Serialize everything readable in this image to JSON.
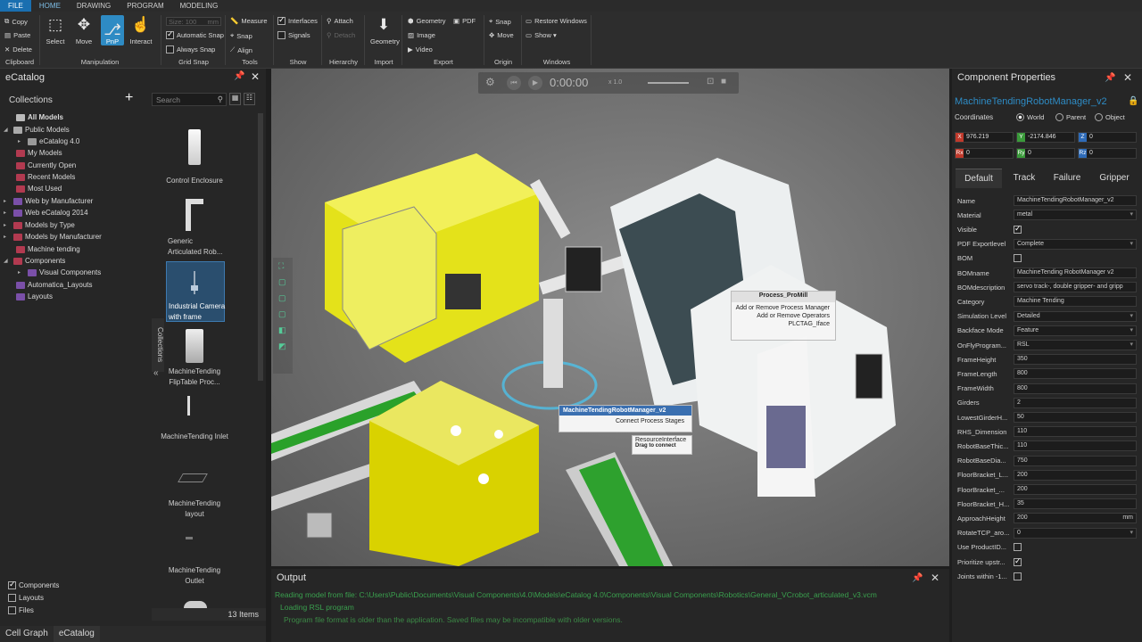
{
  "menu": {
    "items": [
      "FILE",
      "HOME",
      "DRAWING",
      "PROGRAM",
      "MODELING"
    ]
  },
  "ribbon": {
    "clipboard": {
      "copy": "Copy",
      "paste": "Paste",
      "delete": "Delete",
      "label": "Clipboard"
    },
    "manipulation": {
      "select": "Select",
      "move": "Move",
      "pnp": "PnP",
      "interact": "Interact",
      "label": "Manipulation"
    },
    "grid_snap": {
      "size_placeholder": "Size: 100",
      "size_unit": "mm",
      "automatic_snap": "Automatic Snap",
      "always_snap": "Always Snap",
      "label": "Grid Snap"
    },
    "tools": {
      "measure": "Measure",
      "snap": "Snap",
      "align": "Align",
      "label": "Tools"
    },
    "show": {
      "interfaces": "Interfaces",
      "signals": "Signals",
      "label": "Show"
    },
    "hierarchy": {
      "attach": "Attach",
      "detach": "Detach",
      "label": "Hierarchy"
    },
    "import": {
      "geometry": "Geometry",
      "label": "Import"
    },
    "export": {
      "geometry": "Geometry",
      "pdf": "PDF",
      "image": "Image",
      "video": "Video",
      "label": "Export"
    },
    "origin": {
      "snap": "Snap",
      "move": "Move",
      "label": "Origin"
    },
    "windows": {
      "restore": "Restore Windows",
      "show": "Show ▾",
      "label": "Windows"
    }
  },
  "catalog": {
    "title": "eCatalog",
    "collections_title": "Collections",
    "search_placeholder": "Search",
    "tree": [
      "All Models",
      "Public Models",
      "eCatalog 4.0",
      "My Models",
      "Currently Open",
      "Recent Models",
      "Most Used",
      "Web by Manufacturer",
      "Web eCatalog 2014",
      "Models by Type",
      "Models by Manufacturer",
      "Machine tending",
      "Components",
      "Visual Components",
      "Automatica_Layouts",
      "Layouts"
    ],
    "side_tab": "Collections",
    "items": [
      "Control Enclosure",
      "Generic Articulated Rob...",
      "Industrial Camera with frame",
      "MachineTending FlipTable Proc...",
      "MachineTending Inlet",
      "MachineTending layout",
      "MachineTending Outlet"
    ],
    "filters": [
      "Components",
      "Layouts",
      "Files"
    ],
    "count": "13 Items"
  },
  "bottom_tabs": [
    "Cell Graph",
    "eCatalog"
  ],
  "playback": {
    "time": "0:00:00",
    "speed": "x 1.0"
  },
  "scene_labels": {
    "robot_title": "MachineTendingRobotManager_v2",
    "robot_action": "Connect Process Stages",
    "iface_title": "ResourceInterface",
    "iface_hint": "Drag to connect",
    "mill_title": "Process_ProMill",
    "mill_items": [
      "Add or Remove Process Manager",
      "Add or Remove Operators",
      "PLCTAG_Iface"
    ]
  },
  "output": {
    "title": "Output",
    "lines": [
      "Reading model from file: C:\\Users\\Public\\Documents\\Visual Components\\4.0\\Models\\eCatalog 4.0\\Components\\Visual Components\\Robotics\\General_VCrobot_articulated_v3.vcm",
      "Loading RSL program",
      "Program file format is older than the application. Saved files may be incompatible with older versions."
    ]
  },
  "props": {
    "title": "Component Properties",
    "component": "MachineTendingRobotManager_v2",
    "coordinates_label": "Coordinates",
    "coord_options": [
      "World",
      "Parent",
      "Object"
    ],
    "coords": {
      "x": "976.219",
      "y": "-2174.846",
      "z": "0",
      "rx": "0",
      "ry": "0",
      "rz": "0"
    },
    "tabs": [
      "Default",
      "Track",
      "Failure",
      "Gripper"
    ],
    "rows": [
      {
        "name": "Name",
        "value": "MachineTendingRobotManager_v2",
        "type": "text"
      },
      {
        "name": "Material",
        "value": "metal",
        "type": "dropdown"
      },
      {
        "name": "Visible",
        "value": "",
        "type": "check_on"
      },
      {
        "name": "PDF Exportlevel",
        "value": "Complete",
        "type": "dropdown"
      },
      {
        "name": "BOM",
        "value": "",
        "type": "check_off"
      },
      {
        "name": "BOMname",
        "value": "MachineTending RobotManager v2",
        "type": "text"
      },
      {
        "name": "BOMdescription",
        "value": "servo track-, double gripper- and gripp",
        "type": "text"
      },
      {
        "name": "Category",
        "value": "Machine Tending",
        "type": "text"
      },
      {
        "name": "Simulation Level",
        "value": "Detailed",
        "type": "dropdown"
      },
      {
        "name": "Backface Mode",
        "value": "Feature",
        "type": "dropdown"
      },
      {
        "name": "OnFlyProgram...",
        "value": "RSL",
        "type": "dropdown"
      },
      {
        "name": "FrameHeight",
        "value": "350",
        "type": "text"
      },
      {
        "name": "FrameLength",
        "value": "800",
        "type": "text"
      },
      {
        "name": "FrameWidth",
        "value": "800",
        "type": "text"
      },
      {
        "name": "Girders",
        "value": "2",
        "type": "text"
      },
      {
        "name": "LowestGirderH...",
        "value": "50",
        "type": "text"
      },
      {
        "name": "RHS_Dimension",
        "value": "110",
        "type": "text"
      },
      {
        "name": "RobotBaseThic...",
        "value": "110",
        "type": "text"
      },
      {
        "name": "RobotBaseDia...",
        "value": "750",
        "type": "text"
      },
      {
        "name": "FloorBracket_L...",
        "value": "200",
        "type": "text"
      },
      {
        "name": "FloorBracket_...",
        "value": "200",
        "type": "text"
      },
      {
        "name": "FloorBracket_H...",
        "value": "35",
        "type": "text"
      },
      {
        "name": "ApproachHeight",
        "value": "200",
        "type": "text",
        "unit": "mm"
      },
      {
        "name": "RotateTCP_aro...",
        "value": "0",
        "type": "dropdown"
      },
      {
        "name": "Use ProductID...",
        "value": "",
        "type": "check_off"
      },
      {
        "name": "Prioritize upstr...",
        "value": "",
        "type": "check_on"
      },
      {
        "name": "Joints within -1...",
        "value": "",
        "type": "check_off"
      }
    ]
  },
  "colors": {
    "accent": "#2e8bc4",
    "output_text": "#3aa04e",
    "file_tab": "#1a6fb0"
  }
}
